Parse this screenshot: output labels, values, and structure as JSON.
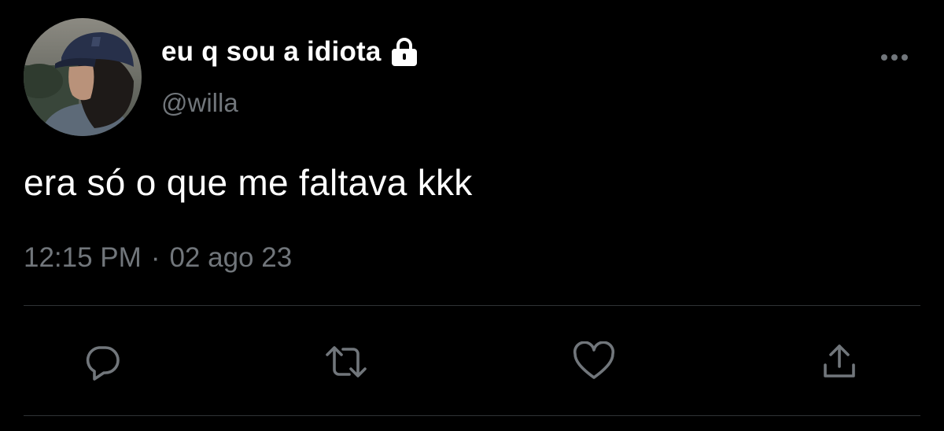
{
  "tweet": {
    "display_name": "eu q sou a idiota",
    "handle": "@willa",
    "text": "era só o que me faltava kkk",
    "time": "12:15 PM",
    "separator": "·",
    "date": "02 ago 23",
    "avatar_alt": "profile photo",
    "icons": {
      "lock": "lock-icon",
      "more": "more-icon",
      "reply": "reply-icon",
      "retweet": "retweet-icon",
      "like": "heart-icon",
      "share": "share-icon"
    }
  },
  "colors": {
    "background": "#000000",
    "primary_text": "#ffffff",
    "secondary_text": "#71767b",
    "divider": "#2f3336",
    "icon": "#71767b"
  }
}
